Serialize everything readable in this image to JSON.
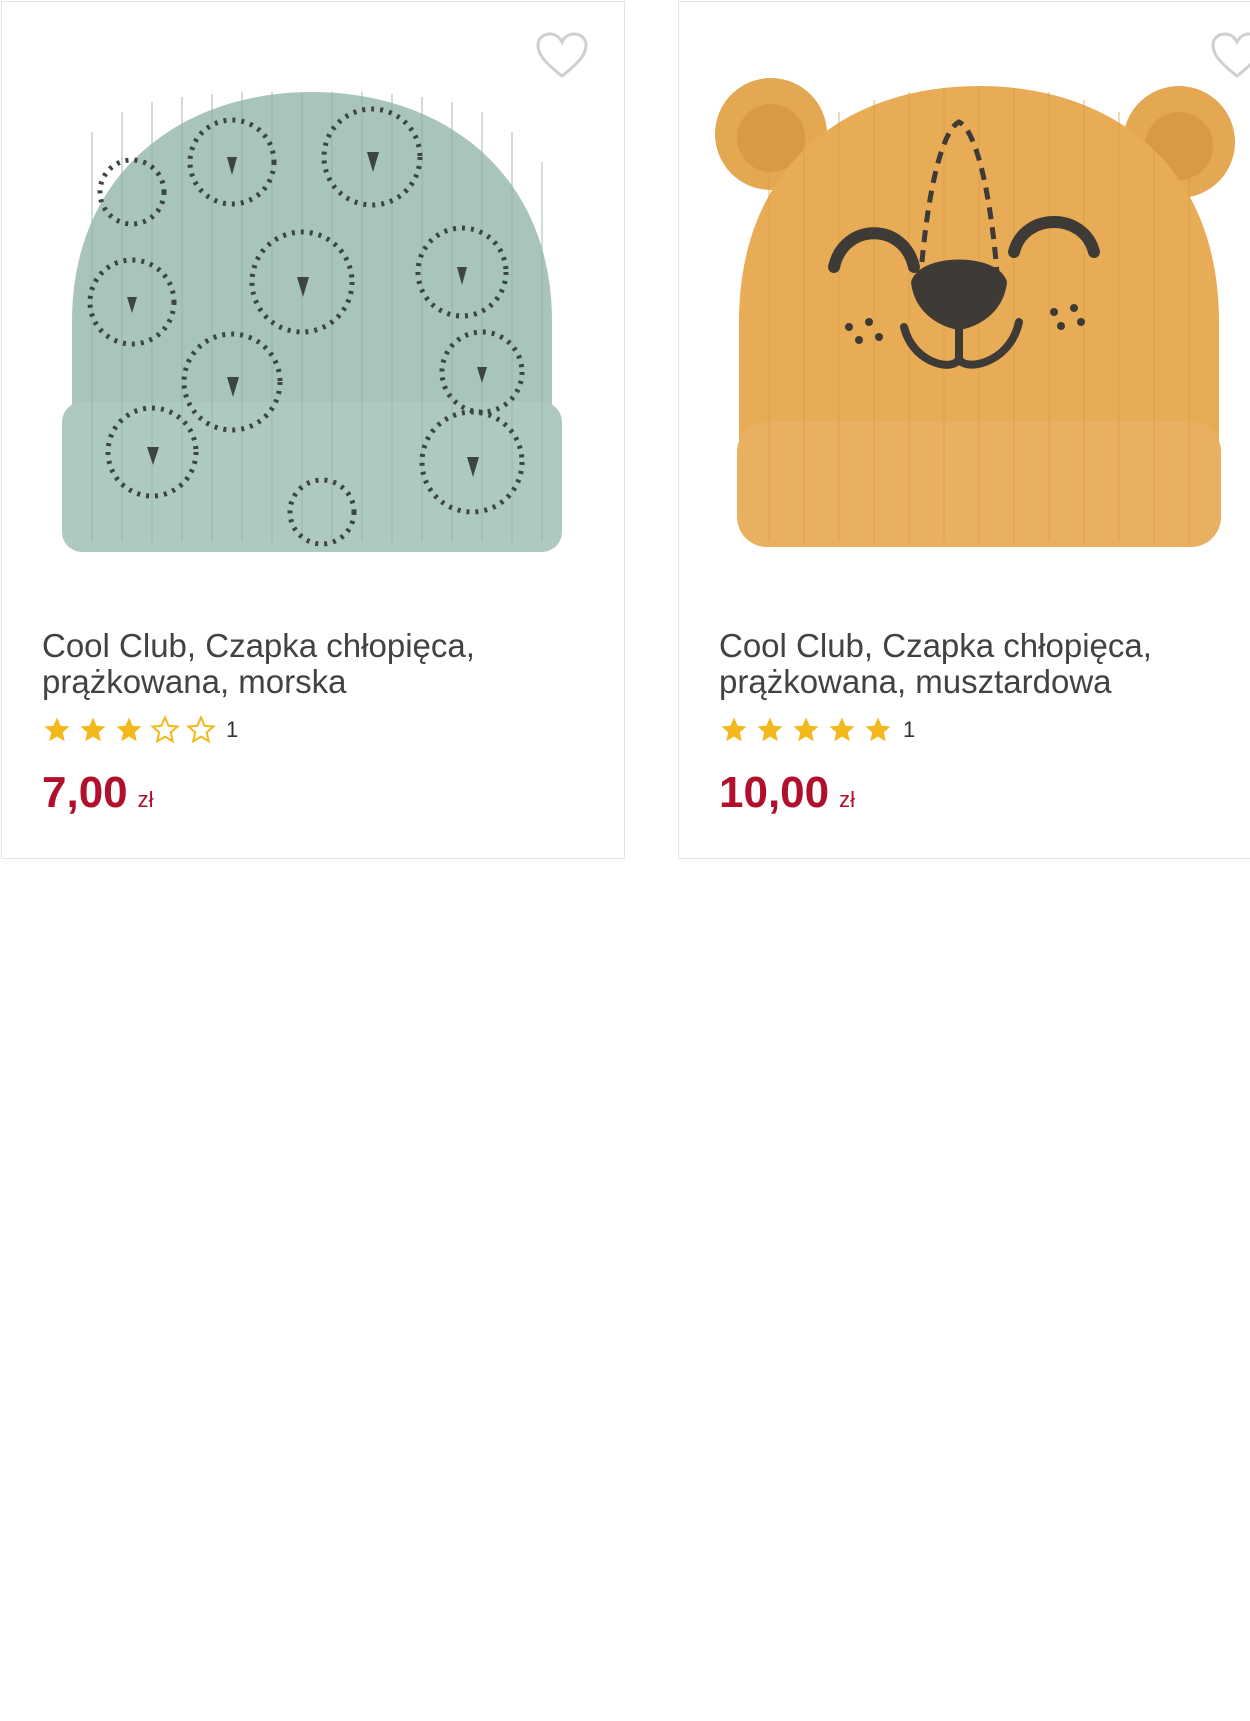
{
  "products": [
    {
      "title": "Cool Club, Czapka chłopięca, prążkowana, morska",
      "rating": 3,
      "rating_max": 5,
      "review_count": "1",
      "price": "7,00",
      "currency": "zł",
      "image_alt": "mint-ribbed-hat-lion-print"
    },
    {
      "title": "Cool Club, Czapka chłopięca, prążkowana, musztardowa",
      "rating": 5,
      "rating_max": 5,
      "review_count": "1",
      "price": "10,00",
      "currency": "zł",
      "image_alt": "mustard-ribbed-hat-bear-face"
    }
  ],
  "icons": {
    "favorite": "heart-outline-icon",
    "star_filled": "star-filled-icon",
    "star_empty": "star-outline-icon"
  },
  "colors": {
    "price": "#b0102b",
    "star": "#f2b81c",
    "title": "#424242",
    "heart": "#cfcfcf",
    "card_border": "#e3e3e3"
  }
}
